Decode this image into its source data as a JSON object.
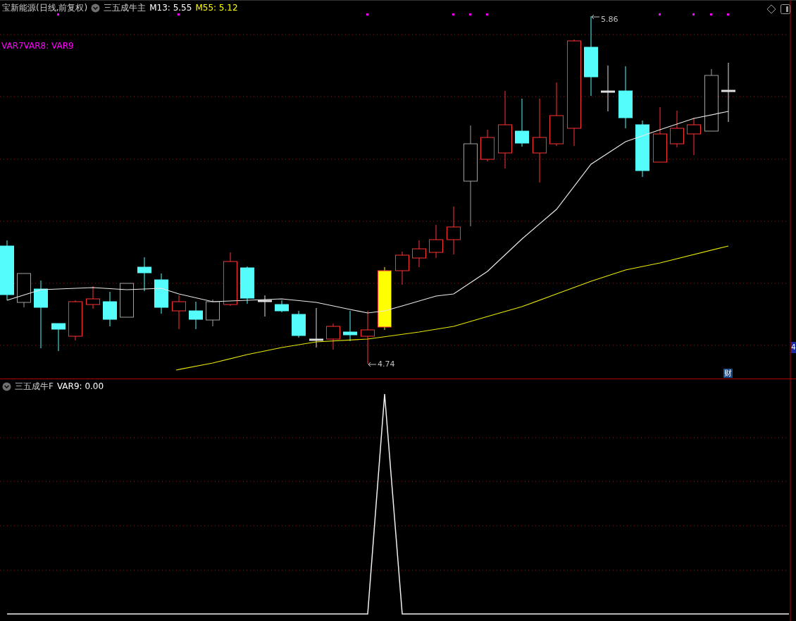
{
  "main_panel": {
    "title": "宝新能源(日线,前复权)",
    "indicator": "三五成牛主",
    "ma13": "M13: 5.55",
    "ma55": "M55: 5.12",
    "legend": "VAR7VAR8: VAR9",
    "high_label": "5.86",
    "low_label": "4.74",
    "finance_badge": "财",
    "axis_badge": "4"
  },
  "sub_panel": {
    "indicator": "三五成牛F",
    "reading": "VAR9: 0.00"
  }
}
